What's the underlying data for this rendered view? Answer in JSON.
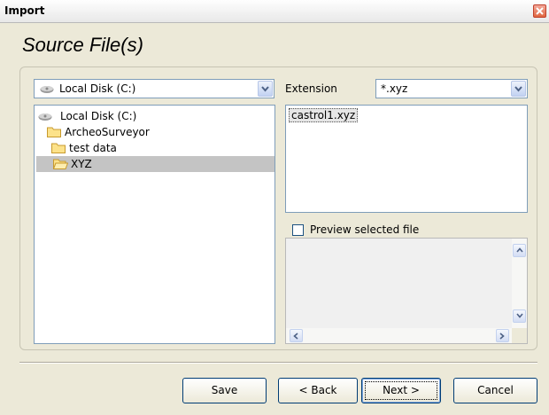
{
  "window": {
    "title": "Import"
  },
  "heading": "Source File(s)",
  "drive_combo": {
    "value": "Local Disk (C:)",
    "icon": "drive-icon"
  },
  "tree": {
    "items": [
      {
        "label": "Local Disk (C:)",
        "icon": "drive-icon",
        "level": 0,
        "selected": false
      },
      {
        "label": "ArcheoSurveyor",
        "icon": "folder-icon",
        "level": 1,
        "selected": false
      },
      {
        "label": "test data",
        "icon": "folder-icon",
        "level": 2,
        "selected": false
      },
      {
        "label": "XYZ",
        "icon": "folder-open-icon",
        "level": 3,
        "selected": true
      }
    ]
  },
  "extension": {
    "label": "Extension",
    "value": "*.xyz"
  },
  "files": [
    "castrol1.xyz"
  ],
  "preview": {
    "label": "Preview selected file",
    "checked": false
  },
  "buttons": {
    "save": "Save",
    "back": "< Back",
    "next": "Next >",
    "cancel": "Cancel"
  },
  "colors": {
    "selection": "#c4c4c4",
    "accent": "#003c74",
    "close": "#e0663f"
  }
}
